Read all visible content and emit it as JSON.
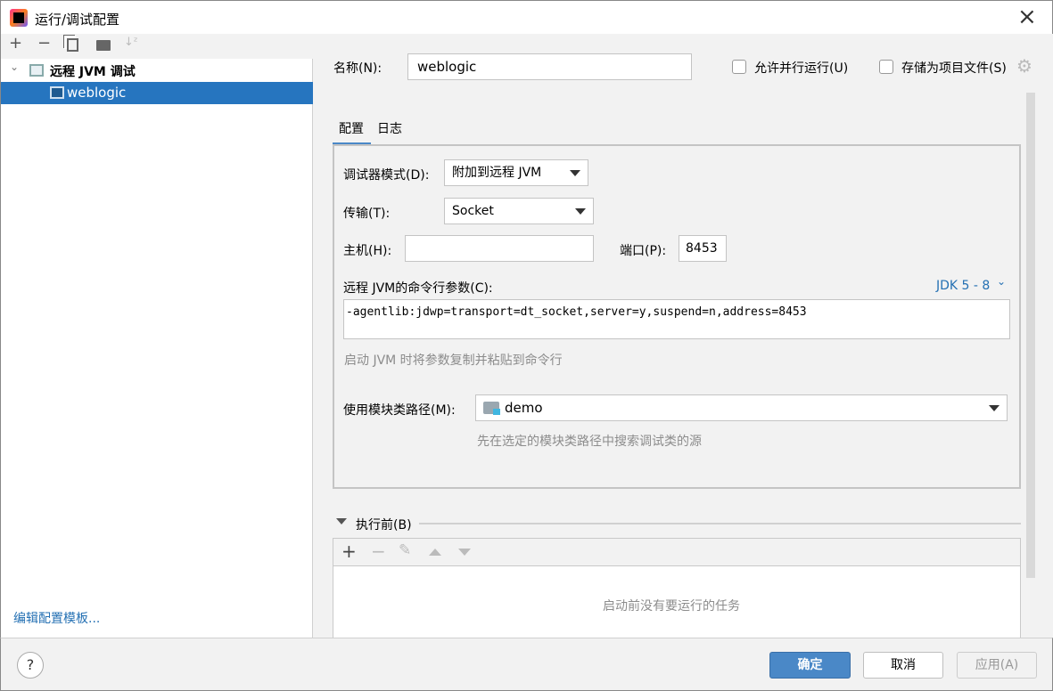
{
  "window": {
    "title": "运行/调试配置",
    "close_icon": "×"
  },
  "left": {
    "toolbar": [
      "+",
      "−",
      "copy",
      "folder-add",
      "sort"
    ],
    "tree": {
      "group": "远程 JVM 调试",
      "item": "weblogic"
    },
    "edit_templates": "编辑配置模板..."
  },
  "form": {
    "name_label": "名称(N):",
    "name_value": "weblogic",
    "allow_parallel": "允许并行运行(U)",
    "store_as_file": "存储为项目文件(S)",
    "tabs": [
      "配置",
      "日志"
    ],
    "debugger_mode_label": "调试器模式(D):",
    "debugger_mode_value": "附加到远程 JVM",
    "transport_label": "传输(T):",
    "transport_value": "Socket",
    "host_label": "主机(H):",
    "host_value": "",
    "port_label": "端口(P):",
    "port_value": "8453",
    "cmd_label": "远程 JVM的命令行参数(C):",
    "jdk_select": "JDK 5 - 8",
    "cmd_value": "-agentlib:jdwp=transport=dt_socket,server=y,suspend=n,address=8453",
    "cmd_hint": "启动 JVM 时将参数复制并粘贴到命令行",
    "module_label": "使用模块类路径(M):",
    "module_value": "demo",
    "module_hint": "先在选定的模块类路径中搜索调试类的源"
  },
  "before_launch": {
    "title": "执行前(B)",
    "empty": "启动前没有要运行的任务"
  },
  "buttons": {
    "help": "?",
    "ok": "确定",
    "cancel": "取消",
    "apply": "应用(A)"
  },
  "colors": {
    "accent": "#2675bf",
    "ok": "#4a88c7"
  }
}
